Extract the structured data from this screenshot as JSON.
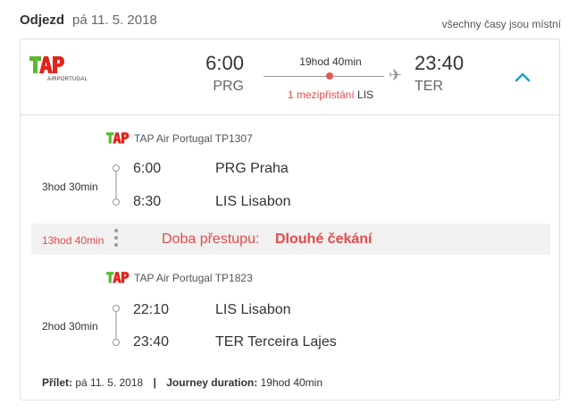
{
  "header": {
    "departure_label": "Odjezd",
    "departure_date": "pá 11. 5. 2018",
    "local_times_note": "všechny časy jsou místní"
  },
  "summary": {
    "airline_logo_text": "TAP",
    "airline_logo_subtext": "AIRPORTUGAL",
    "departure_time": "6:00",
    "departure_code": "PRG",
    "total_duration": "19hod 40min",
    "stops_count": "1 mezipřistání",
    "stops_airport": "LIS",
    "arrival_time": "23:40",
    "arrival_code": "TER",
    "collapse_icon": "chevron-up-icon"
  },
  "segments": [
    {
      "airline": "TAP Air Portugal TP1307",
      "duration": "3hod 30min",
      "from_time": "6:00",
      "from_place": "PRG Praha",
      "to_time": "8:30",
      "to_place": "LIS Lisabon"
    },
    {
      "airline": "TAP Air Portugal TP1823",
      "duration": "2hod 30min",
      "from_time": "22:10",
      "from_place": "LIS Lisabon",
      "to_time": "23:40",
      "to_place": "TER Terceira Lajes"
    }
  ],
  "transfer": {
    "duration": "13hod 40min",
    "label": "Doba přestupu:",
    "note": "Dlouhé čekání"
  },
  "footer": {
    "arrival_label": "Přílet:",
    "arrival_date": "pá 11. 5. 2018",
    "separator": "|",
    "journey_label": "Journey duration:",
    "journey_duration": "19hod 40min"
  },
  "colors": {
    "accent_red": "#e34b4b",
    "chevron_blue": "#1a9fd6",
    "tap_green": "#5cb82e",
    "tap_red": "#e2231a"
  }
}
